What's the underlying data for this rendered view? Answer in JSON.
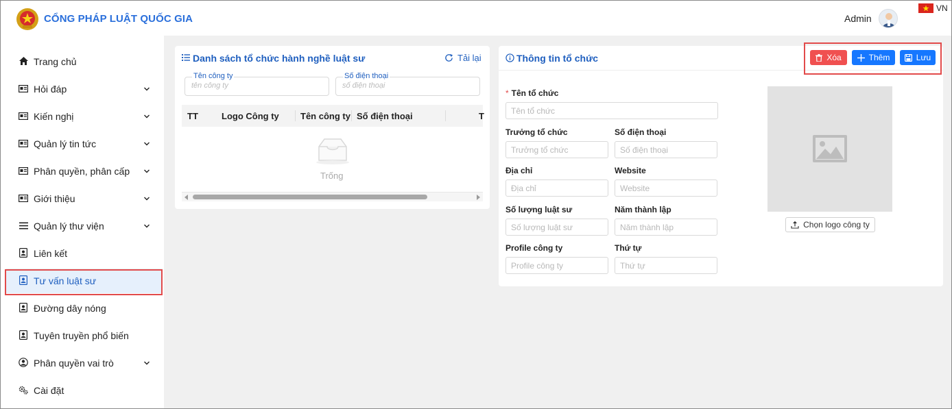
{
  "header": {
    "title": "CỔNG PHÁP LUẬT QUỐC GIA",
    "user_name": "Admin",
    "language": "VN"
  },
  "sidebar": {
    "items": [
      {
        "label": "Trang chủ",
        "icon": "home-icon",
        "has_children": false
      },
      {
        "label": "Hỏi đáp",
        "icon": "card-icon",
        "has_children": true
      },
      {
        "label": "Kiến nghị",
        "icon": "card-icon",
        "has_children": true
      },
      {
        "label": "Quản lý tin tức",
        "icon": "card-icon",
        "has_children": true
      },
      {
        "label": "Phân quyền, phân cấp",
        "icon": "card-icon",
        "has_children": true
      },
      {
        "label": "Giới thiệu",
        "icon": "card-icon",
        "has_children": true
      },
      {
        "label": "Quản lý thư viện",
        "icon": "menu-icon",
        "has_children": true
      },
      {
        "label": "Liên kết",
        "icon": "contact-icon",
        "has_children": false
      },
      {
        "label": "Tư vấn luật sư",
        "icon": "contact-icon",
        "has_children": false,
        "active": true
      },
      {
        "label": "Đường dây nóng",
        "icon": "contact-icon",
        "has_children": false
      },
      {
        "label": "Tuyên truyền phổ biến",
        "icon": "contact-icon",
        "has_children": false
      },
      {
        "label": "Phân quyền vai trò",
        "icon": "user-circle-icon",
        "has_children": true
      },
      {
        "label": "Cài đặt",
        "icon": "gears-icon",
        "has_children": false
      }
    ]
  },
  "list_panel": {
    "title": "Danh sách tổ chức hành nghề luật sư",
    "reload_label": "Tải lại",
    "filters": {
      "company_name": {
        "label": "Tên công ty",
        "placeholder": "tên công ty"
      },
      "phone": {
        "label": "Số điện thoại",
        "placeholder": "số điện thoại"
      }
    },
    "columns": [
      "TT",
      "Logo Công ty",
      "Tên công ty",
      "Số điện thoại",
      "T"
    ],
    "empty_text": "Trống"
  },
  "detail_panel": {
    "title": "Thông tin tổ chức",
    "buttons": {
      "delete": "Xóa",
      "add": "Thêm",
      "save": "Lưu"
    },
    "fields": {
      "org_name": {
        "label": "Tên tổ chức",
        "placeholder": "Tên tổ chức",
        "required": true
      },
      "head": {
        "label": "Trưởng tổ chức",
        "placeholder": "Trưởng tổ chức"
      },
      "phone": {
        "label": "Số điện thoại",
        "placeholder": "Số điện thoại"
      },
      "address": {
        "label": "Địa chỉ",
        "placeholder": "Địa chỉ"
      },
      "website": {
        "label": "Website",
        "placeholder": "Website"
      },
      "lawyer_count": {
        "label": "Số lượng luật sư",
        "placeholder": "Số lượng luật sư"
      },
      "founded_year": {
        "label": "Năm thành lập",
        "placeholder": "Năm thành lập"
      },
      "profile": {
        "label": "Profile công ty",
        "placeholder": "Profile công ty"
      },
      "order": {
        "label": "Thứ tự",
        "placeholder": "Thứ tự"
      }
    },
    "choose_logo_label": "Chọn logo công ty"
  },
  "colors": {
    "accent": "#1677ff",
    "title_blue": "#1f5fbf",
    "danger": "#f05050",
    "highlight_border": "#e24a4a"
  }
}
